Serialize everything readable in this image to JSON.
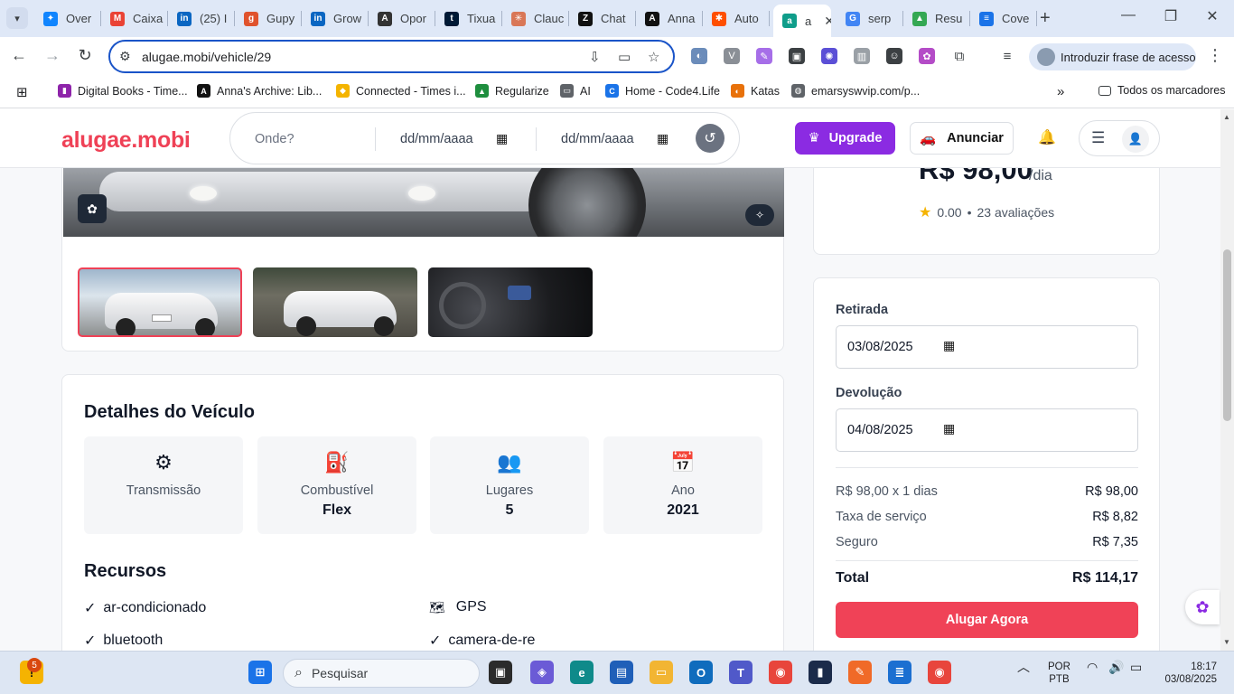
{
  "browser": {
    "tabs": [
      {
        "label": "Over",
        "icon": "bluesky-icon",
        "color": "#1185fe",
        "glyph": "✦"
      },
      {
        "label": "Caixa",
        "icon": "gmail-icon",
        "color": "#ea4335",
        "glyph": "M"
      },
      {
        "label": "(25) I",
        "icon": "linkedin-icon",
        "color": "#0a66c2",
        "glyph": "in"
      },
      {
        "label": "Gupy",
        "icon": "gupy-icon",
        "color": "#e0532d",
        "glyph": "g"
      },
      {
        "label": "Grow",
        "icon": "linkedin-icon",
        "color": "#0a66c2",
        "glyph": "in"
      },
      {
        "label": "Opor",
        "icon": "opor-icon",
        "color": "#333333",
        "glyph": "A"
      },
      {
        "label": "Tixua",
        "icon": "tumblr-icon",
        "color": "#001935",
        "glyph": "t"
      },
      {
        "label": "Clauc",
        "icon": "claude-icon",
        "color": "#d97757",
        "glyph": "✳"
      },
      {
        "label": "Chat",
        "icon": "zchat-icon",
        "color": "#111111",
        "glyph": "Z"
      },
      {
        "label": "Anna",
        "icon": "annas-archive-icon",
        "color": "#111111",
        "glyph": "A"
      },
      {
        "label": "Auto",
        "icon": "zapier-icon",
        "color": "#ff4f00",
        "glyph": "✱"
      },
      {
        "label": "a",
        "icon": "alugae-icon",
        "color": "#0f9d8a",
        "glyph": "a"
      },
      {
        "label": "serp",
        "icon": "google-icon",
        "color": "#4285f4",
        "glyph": "G"
      },
      {
        "label": "Resu",
        "icon": "drive-icon",
        "color": "#34a853",
        "glyph": "▲"
      },
      {
        "label": "Cove",
        "icon": "docs-icon",
        "color": "#1a73e8",
        "glyph": "≡"
      }
    ],
    "url": "alugae.mobi/vehicle/29",
    "profile_label": "Introduzir frase de acesso",
    "bookmarks": [
      {
        "label": "Digital Books - Time...",
        "icon": "book-icon",
        "color": "#8e24aa",
        "glyph": "▮"
      },
      {
        "label": "Anna's Archive: Lib...",
        "icon": "annas-archive-icon",
        "color": "#111111",
        "glyph": "A"
      },
      {
        "label": "Connected - Times i...",
        "icon": "connected-icon",
        "color": "#f4b400",
        "glyph": "◆"
      },
      {
        "label": "Regularize",
        "icon": "regularize-icon",
        "color": "#1e8e3e",
        "glyph": "▲"
      },
      {
        "label": "AI",
        "icon": "folder-icon",
        "color": "#5f6368",
        "glyph": "▭"
      },
      {
        "label": "Home - Code4.Life",
        "icon": "code4life-icon",
        "color": "#1a73e8",
        "glyph": "C"
      },
      {
        "label": "Katas",
        "icon": "katas-icon",
        "color": "#e8710a",
        "glyph": "◐"
      },
      {
        "label": "emarsyswvip.com/p...",
        "icon": "globe-icon",
        "color": "#5f6368",
        "glyph": "◍"
      }
    ],
    "all_bookmarks_label": "Todos os marcadores"
  },
  "site": {
    "logo": "alugae.mobi",
    "search": {
      "placeholder": "Onde?",
      "date1": "dd/mm/aaaa",
      "date2": "dd/mm/aaaa"
    },
    "upgrade_label": "Upgrade",
    "anunciar_label": "Anunciar"
  },
  "vehicle": {
    "details_title": "Detalhes do Veículo",
    "stats": [
      {
        "label": "Transmissão",
        "value": "",
        "icon": "gear-icon"
      },
      {
        "label": "Combustível",
        "value": "Flex",
        "icon": "fuel-pump-icon"
      },
      {
        "label": "Lugares",
        "value": "5",
        "icon": "users-icon"
      },
      {
        "label": "Ano",
        "value": "2021",
        "icon": "calendar-icon"
      }
    ],
    "features_title": "Recursos",
    "features": [
      {
        "text": "ar-condicionado",
        "mark": "✓"
      },
      {
        "text": "GPS",
        "mark": "🗺"
      },
      {
        "text": "bluetooth",
        "mark": "✓"
      },
      {
        "text": "camera-de-re",
        "mark": "✓"
      }
    ]
  },
  "pricing": {
    "price": "R$ 98,00",
    "per": "/dia",
    "rating": "0.00",
    "reviews": "23 avaliações",
    "pickup_label": "Retirada",
    "pickup_date": "03/08/2025",
    "return_label": "Devolução",
    "return_date": "04/08/2025",
    "lines": [
      {
        "label": "R$ 98,00 x 1 dias",
        "value": "R$ 98,00"
      },
      {
        "label": "Taxa de serviço",
        "value": "R$ 8,82"
      },
      {
        "label": "Seguro",
        "value": "R$ 7,35"
      }
    ],
    "total_label": "Total",
    "total_value": "R$ 114,17",
    "cta": "Alugar Agora"
  },
  "taskbar": {
    "search_placeholder": "Pesquisar",
    "notif_count": "5",
    "lang": "POR",
    "layout": "PTB",
    "time": "18:17",
    "date": "03/08/2025"
  }
}
